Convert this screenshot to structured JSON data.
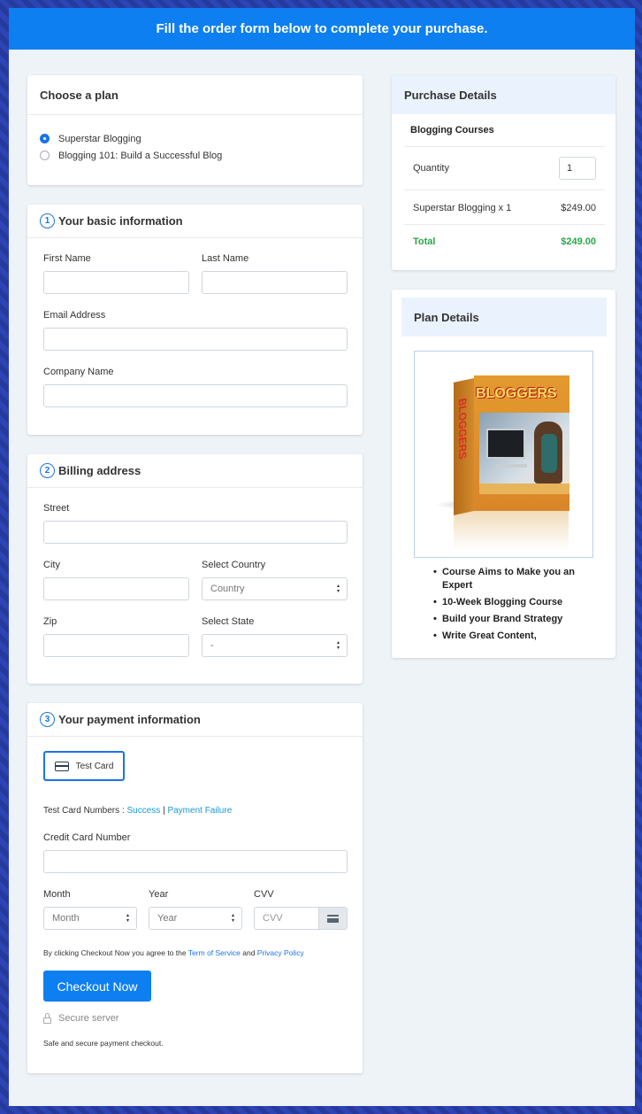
{
  "header": {
    "title": "Fill the order form below to complete your purchase."
  },
  "plan": {
    "title": "Choose a plan",
    "options": [
      {
        "label": "Superstar Blogging",
        "selected": true
      },
      {
        "label": "Blogging 101: Build a Successful Blog",
        "selected": false
      }
    ]
  },
  "basic": {
    "step": "1",
    "title": "Your basic information",
    "first_name_label": "First Name",
    "last_name_label": "Last Name",
    "email_label": "Email Address",
    "company_label": "Company Name"
  },
  "billing": {
    "step": "2",
    "title": "Billing address",
    "street_label": "Street",
    "city_label": "City",
    "country_label": "Select Country",
    "country_value": "Country",
    "zip_label": "Zip",
    "state_label": "Select State",
    "state_value": "-"
  },
  "payment": {
    "step": "3",
    "title": "Your payment information",
    "test_card_label": "Test Card",
    "test_numbers_label": "Test Card Numbers :",
    "success_link": "Success",
    "separator": "|",
    "failure_link": "Payment Failure",
    "cc_label": "Credit Card Number",
    "month_label": "Month",
    "month_value": "Month",
    "year_label": "Year",
    "year_value": "Year",
    "cvv_label": "CVV",
    "cvv_placeholder": "CVV",
    "terms_prefix": "By clicking Checkout Now you agree to the",
    "terms_link": "Term of Service",
    "terms_and": "and",
    "privacy_link": "Privacy Policy",
    "checkout_button": "Checkout Now",
    "secure_label": "Secure server",
    "safe_text": "Safe and secure payment checkout."
  },
  "purchase": {
    "title": "Purchase Details",
    "product": "Blogging Courses",
    "quantity_label": "Quantity",
    "quantity_value": "1",
    "line_item": "Superstar Blogging x 1",
    "line_price": "$249.00",
    "total_label": "Total",
    "total_value": "$249.00"
  },
  "plan_details": {
    "title": "Plan Details",
    "box_text": "BLOGGERS",
    "box_side_text": "BLOGGERS",
    "bullets": [
      "Course Aims to Make you an Expert",
      "10-Week Blogging Course",
      "Build your Brand Strategy",
      "Write Great Content,"
    ]
  },
  "colors": {
    "accent": "#0d7ff0",
    "total_green": "#28a745",
    "link": "#1a9ad6"
  }
}
